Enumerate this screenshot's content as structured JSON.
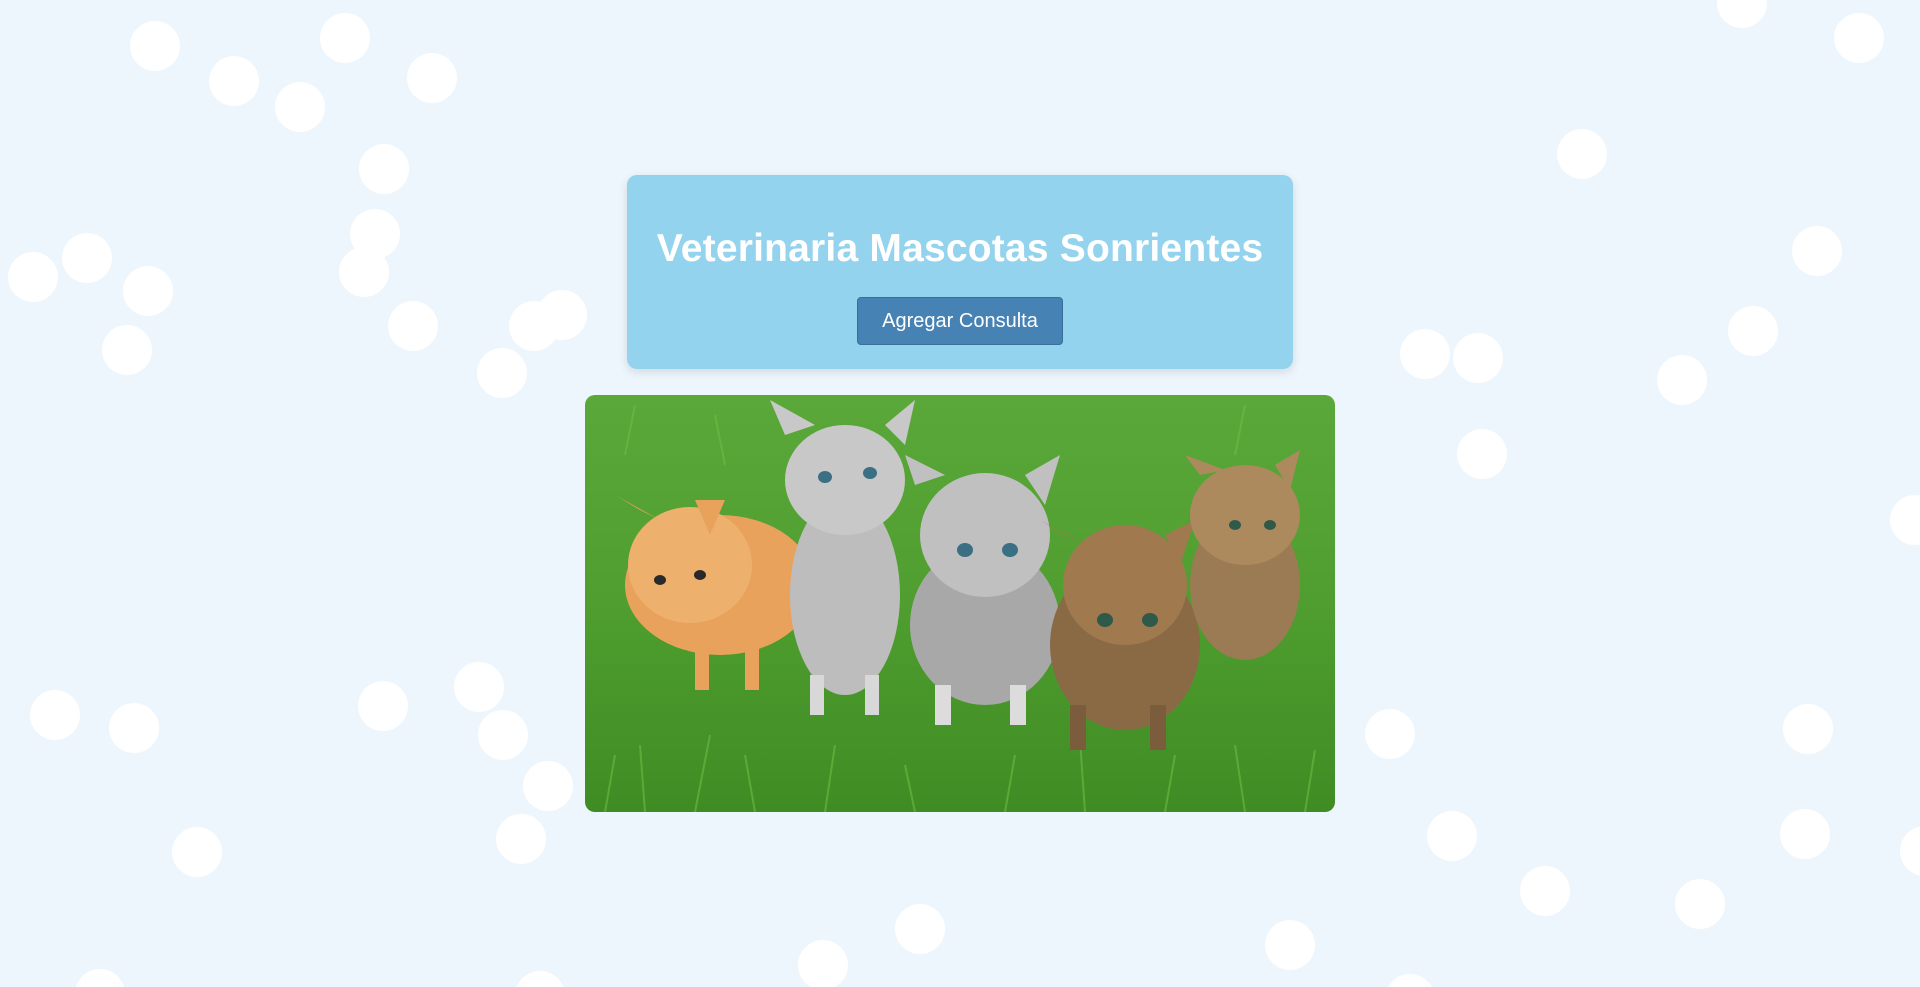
{
  "header": {
    "title": "Veterinaria Mascotas Sonrientes",
    "add_consult_label": "Agregar Consulta"
  },
  "colors": {
    "background": "#eef6fd",
    "header_card": "#87ceeb",
    "button": "#4682b4",
    "button_text": "#ffffff",
    "title_text": "#ffffff"
  },
  "image": {
    "subject": "five kittens on grass",
    "icon": "kittens-photo"
  }
}
